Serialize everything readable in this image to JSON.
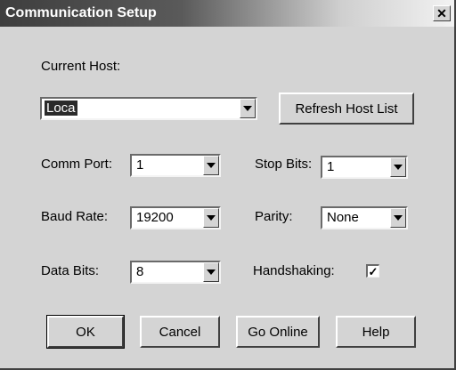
{
  "window": {
    "title": "Communication Setup",
    "close_glyph": "✕"
  },
  "host": {
    "label": "Current Host:",
    "value": "Loca",
    "refresh_label": "Refresh Host List"
  },
  "comm_port": {
    "label": "Comm Port:",
    "value": "1"
  },
  "baud_rate": {
    "label": "Baud Rate:",
    "value": "19200"
  },
  "data_bits": {
    "label": "Data Bits:",
    "value": "8"
  },
  "stop_bits": {
    "label": "Stop Bits:",
    "value": "1"
  },
  "parity": {
    "label": "Parity:",
    "value": "None"
  },
  "handshaking": {
    "label": "Handshaking:",
    "checked": true,
    "check_glyph": "✓"
  },
  "buttons": {
    "ok": "OK",
    "cancel": "Cancel",
    "go_online": "Go Online",
    "help": "Help"
  }
}
